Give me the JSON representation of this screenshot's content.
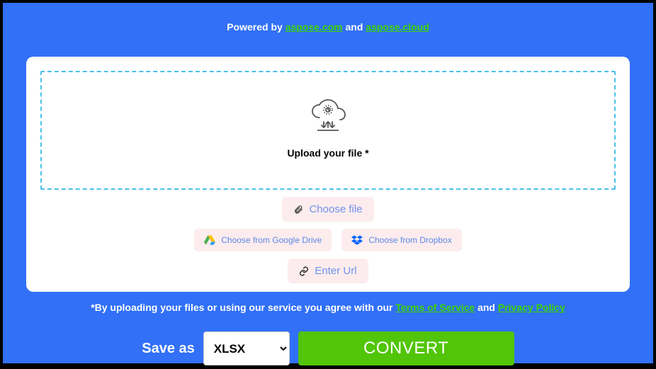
{
  "poweredBy": {
    "prefix": "Powered by ",
    "link1": "aspose.com",
    "middle": " and ",
    "link2": "aspose.cloud"
  },
  "dropzone": {
    "label": "Upload your file *"
  },
  "buttons": {
    "chooseFile": "Choose file",
    "googleDrive": "Choose from Google Drive",
    "dropbox": "Choose from Dropbox",
    "enterUrl": "Enter Url"
  },
  "agreement": {
    "prefix": "*By uploading your files or using our service you agree with our ",
    "tos": "Terms of Service",
    "middle": " and ",
    "privacy": "Privacy Policy"
  },
  "convert": {
    "saveAsLabel": "Save as",
    "selectedFormat": "XLSX",
    "convertLabel": "CONVERT"
  }
}
